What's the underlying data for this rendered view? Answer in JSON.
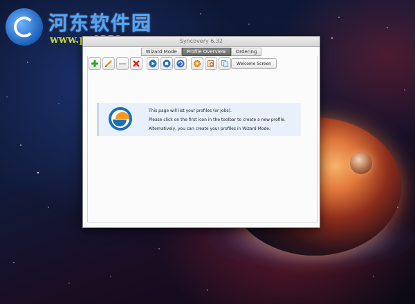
{
  "watermark": {
    "title": "河东软件园",
    "url": "www.pc0359.cn"
  },
  "window": {
    "title": "Syncovery 6.32"
  },
  "tabs": [
    {
      "label": "Wizard Mode",
      "active": false
    },
    {
      "label": "Profile Overview",
      "active": true
    },
    {
      "label": "Ordering",
      "active": false
    }
  ],
  "toolbar": {
    "icons": [
      "plus-icon",
      "pencil-icon",
      "minus-icon",
      "delete-x-icon",
      "play-icon",
      "stop-icon",
      "refresh-icon",
      "gear-icon",
      "search-icon",
      "copy-icon"
    ],
    "welcome_label": "Welcome Screen"
  },
  "info": {
    "line1": "This page will list your profiles (or jobs).",
    "line2": "Please click on the first icon in the toolbar to create a new profile.",
    "line3": "Alternatively, you can create your profiles in Wizard Mode."
  },
  "colors": {
    "active_tab": "#6a6a6a",
    "info_bg": "#e7f0fb",
    "logo_blue": "#1e6fb5",
    "logo_orange": "#f39a1c"
  }
}
